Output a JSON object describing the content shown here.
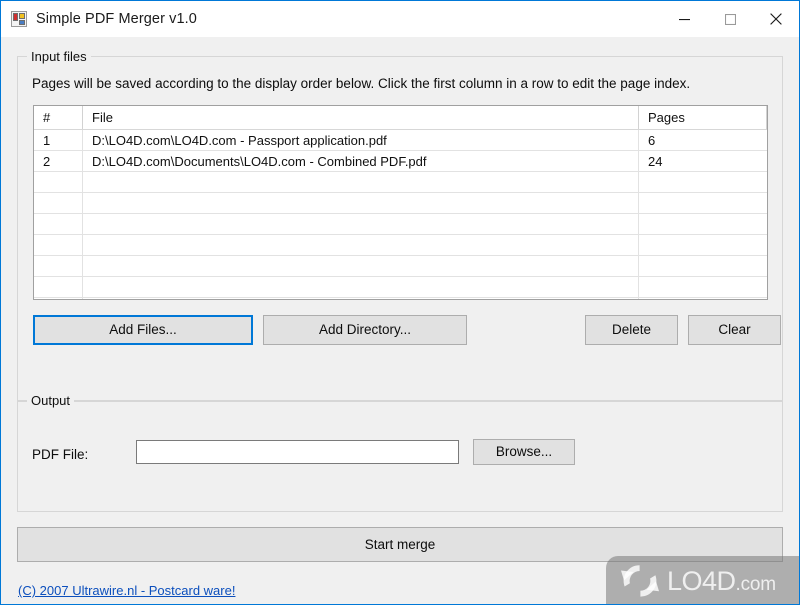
{
  "window": {
    "title": "Simple PDF Merger v1.0",
    "icon": "app-window-panes-icon",
    "accent_color": "#0078d7",
    "face_color": "#f0f0f0",
    "controls": {
      "minimize": "minimize-icon",
      "maximize": "maximize-icon",
      "close": "close-icon"
    }
  },
  "input_group": {
    "title": "Input files",
    "hint": "Pages will be saved according to the display order below. Click the first column in a row to edit the page index.",
    "grid": {
      "columns": [
        "#",
        "File",
        "Pages"
      ],
      "rows": [
        {
          "num": "1",
          "file": "D:\\LO4D.com\\LO4D.com - Passport application.pdf",
          "pages": "6"
        },
        {
          "num": "2",
          "file": "D:\\LO4D.com\\Documents\\LO4D.com - Combined PDF.pdf",
          "pages": "24"
        }
      ],
      "empty_row_count": 7
    },
    "buttons": {
      "add_files": "Add Files...",
      "add_directory": "Add Directory...",
      "delete": "Delete",
      "clear": "Clear"
    },
    "focused_button": "Add Files..."
  },
  "output_group": {
    "title": "Output",
    "pdf_file_label": "PDF File:",
    "pdf_file_value": "",
    "pdf_file_placeholder": "",
    "browse": "Browse..."
  },
  "actions": {
    "start_merge": "Start merge"
  },
  "footer": {
    "link_text": "(C) 2007 Ultrawire.nl - Postcard ware!",
    "link_color": "#0c4fbd"
  },
  "watermark": {
    "brand": "LO4D",
    "suffix": ".com",
    "logo": "circular-arrows-icon"
  }
}
